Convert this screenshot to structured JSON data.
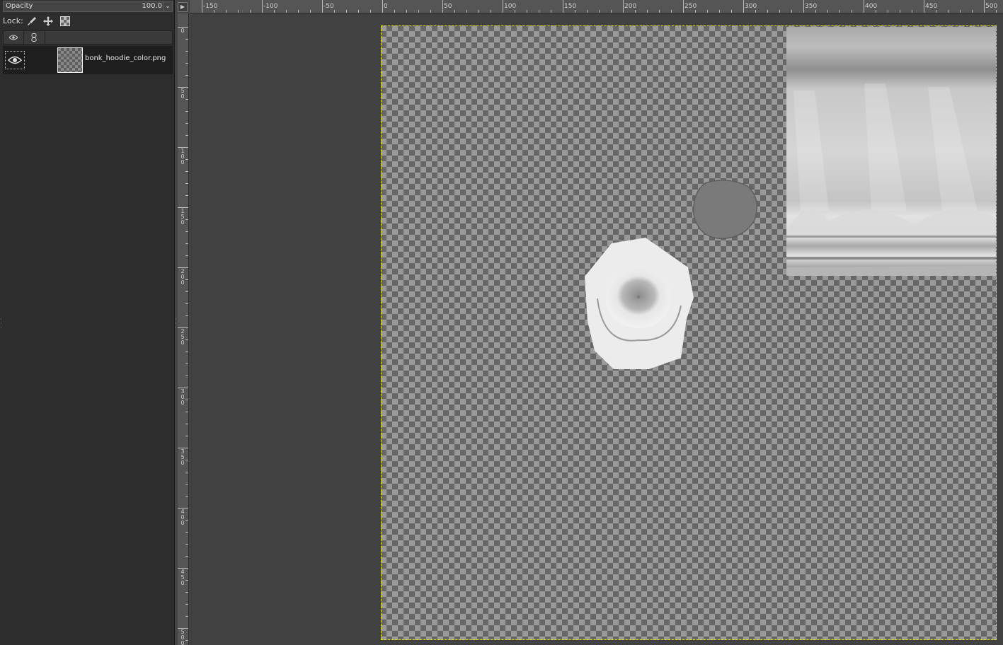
{
  "layers_panel": {
    "opacity_label": "Opacity",
    "opacity_value": "100.0",
    "lock_label": "Lock:",
    "lock_icons": [
      "paintbrush-lock-icon",
      "move-lock-icon",
      "alpha-lock-icon"
    ],
    "header_icons": [
      "eye-icon",
      "chain-link-icon"
    ],
    "layers": [
      {
        "name": "bonk_hoodie_color.png",
        "visible": true,
        "thumbnail": "checkerboard"
      }
    ]
  },
  "canvas": {
    "horizontal_ruler": [
      "-150",
      "-100",
      "-50",
      "0",
      "50",
      "100",
      "150",
      "200",
      "250",
      "300",
      "350",
      "400",
      "450",
      "500"
    ],
    "vertical_ruler": [
      "0",
      "50",
      "100",
      "150",
      "200",
      "250",
      "300",
      "350",
      "400",
      "450",
      "500"
    ],
    "boundary_color": "#e6e600",
    "checker_dark": "#666666",
    "checker_light": "#999999"
  }
}
